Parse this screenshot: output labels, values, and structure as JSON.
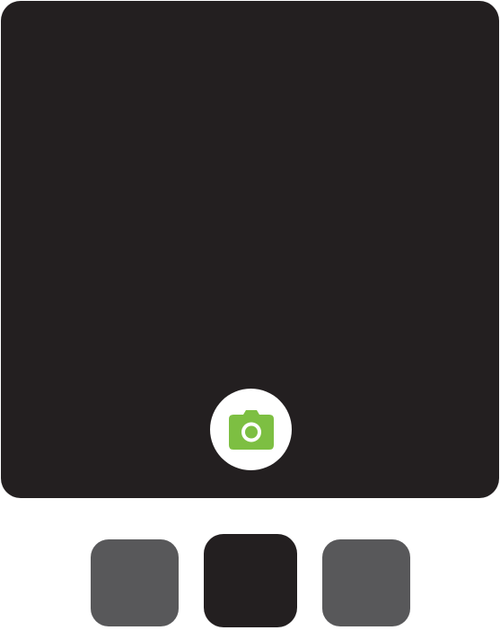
{
  "camera": {
    "preview_color": "#231f20",
    "shutter_button_color": "#ffffff",
    "shutter_icon": "camera-icon",
    "shutter_icon_color": "#7dbf42"
  },
  "thumbnails": {
    "items": [
      {
        "color": "#58585a",
        "selected": false
      },
      {
        "color": "#231f20",
        "selected": true
      },
      {
        "color": "#58585a",
        "selected": false
      }
    ]
  }
}
